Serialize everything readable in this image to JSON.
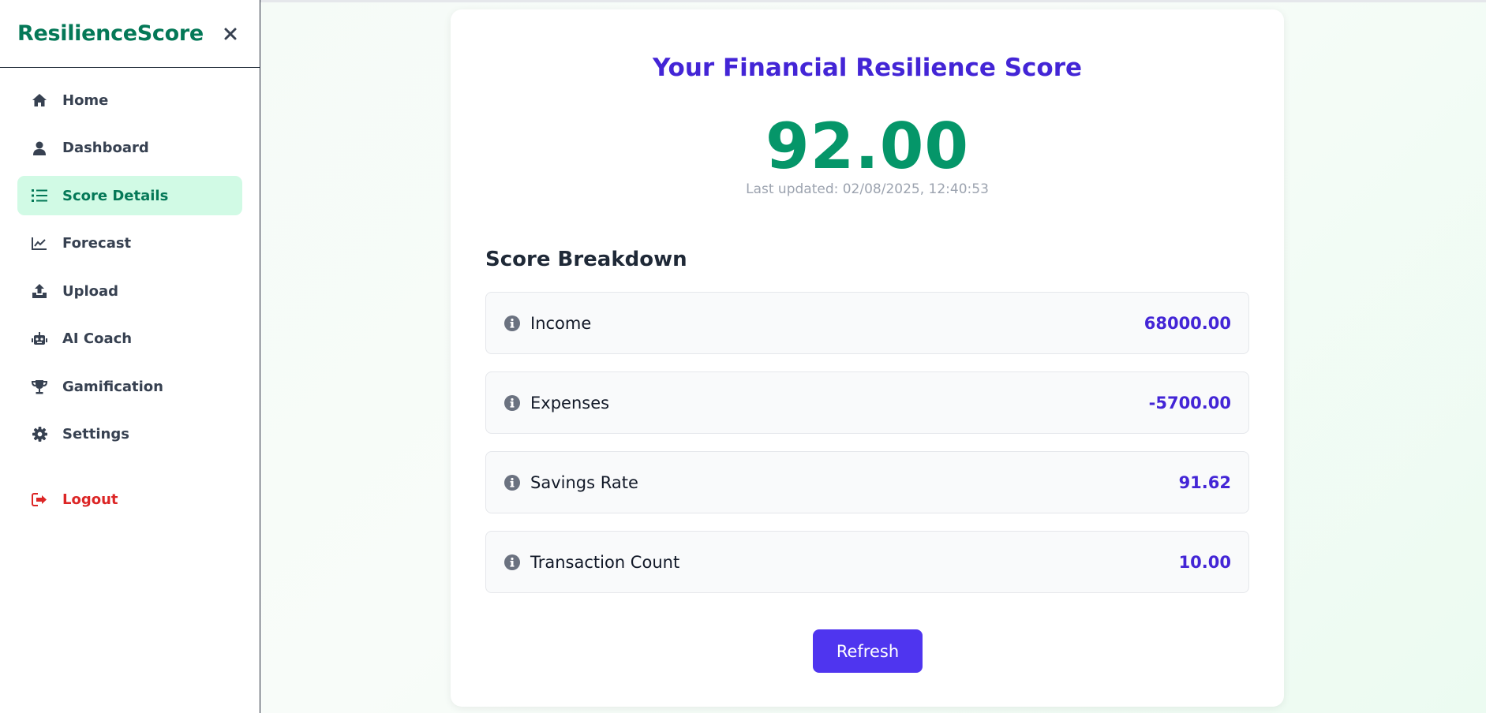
{
  "app": {
    "brand": "ResilienceScore"
  },
  "sidebar": {
    "items": [
      {
        "label": "Home",
        "icon": "home-icon"
      },
      {
        "label": "Dashboard",
        "icon": "user-icon"
      },
      {
        "label": "Score Details",
        "icon": "list-icon",
        "active": true
      },
      {
        "label": "Forecast",
        "icon": "chart-line-icon"
      },
      {
        "label": "Upload",
        "icon": "upload-icon"
      },
      {
        "label": "AI Coach",
        "icon": "robot-icon"
      },
      {
        "label": "Gamification",
        "icon": "trophy-icon"
      },
      {
        "label": "Settings",
        "icon": "gear-icon"
      }
    ],
    "logout": {
      "label": "Logout",
      "icon": "logout-icon"
    }
  },
  "main": {
    "title": "Your Financial Resilience Score",
    "score": "92.00",
    "updated": "Last updated: 02/08/2025, 12:40:53",
    "breakdown_title": "Score Breakdown",
    "breakdown": [
      {
        "label": "Income",
        "value": "68000.00"
      },
      {
        "label": "Expenses",
        "value": "-5700.00"
      },
      {
        "label": "Savings Rate",
        "value": "91.62"
      },
      {
        "label": "Transaction Count",
        "value": "10.00"
      }
    ],
    "refresh_label": "Refresh"
  },
  "colors": {
    "brand": "#047857",
    "active_bg": "#d1fae5",
    "title": "#4325d6",
    "score": "#059669",
    "button": "#4f35ef",
    "logout": "#dc2626"
  }
}
